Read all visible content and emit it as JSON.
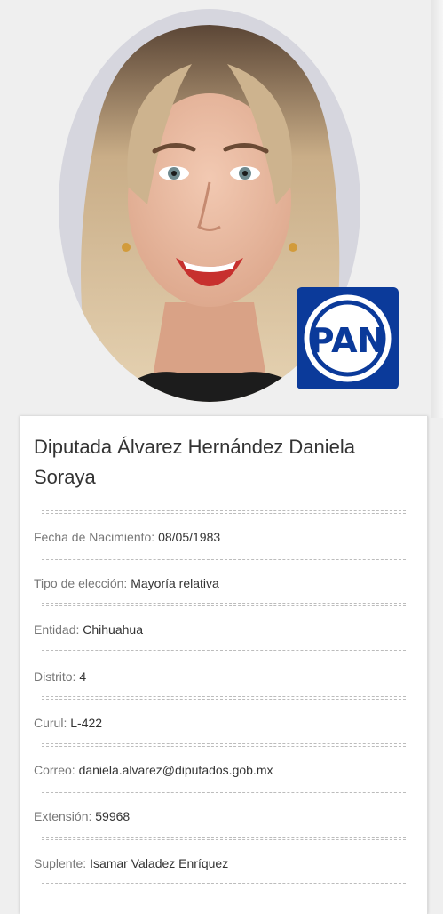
{
  "profile": {
    "title": "Diputada Álvarez Hernández Daniela Soraya",
    "party": "PAN",
    "fields": [
      {
        "label": "Fecha de Nacimiento:",
        "value": "08/05/1983"
      },
      {
        "label": "Tipo de elección:",
        "value": "Mayoría relativa"
      },
      {
        "label": "Entidad:",
        "value": "Chihuahua"
      },
      {
        "label": "Distrito:",
        "value": "4"
      },
      {
        "label": "Curul:",
        "value": "L-422"
      },
      {
        "label": "Correo:",
        "value": "daniela.alvarez@diputados.gob.mx"
      },
      {
        "label": "Extensión:",
        "value": "59968"
      },
      {
        "label": "Suplente:",
        "value": "Isamar Valadez Enríquez"
      }
    ]
  },
  "colors": {
    "party_blue": "#0b3a9a",
    "card_bg": "#ffffff",
    "page_bg": "#efefef"
  }
}
